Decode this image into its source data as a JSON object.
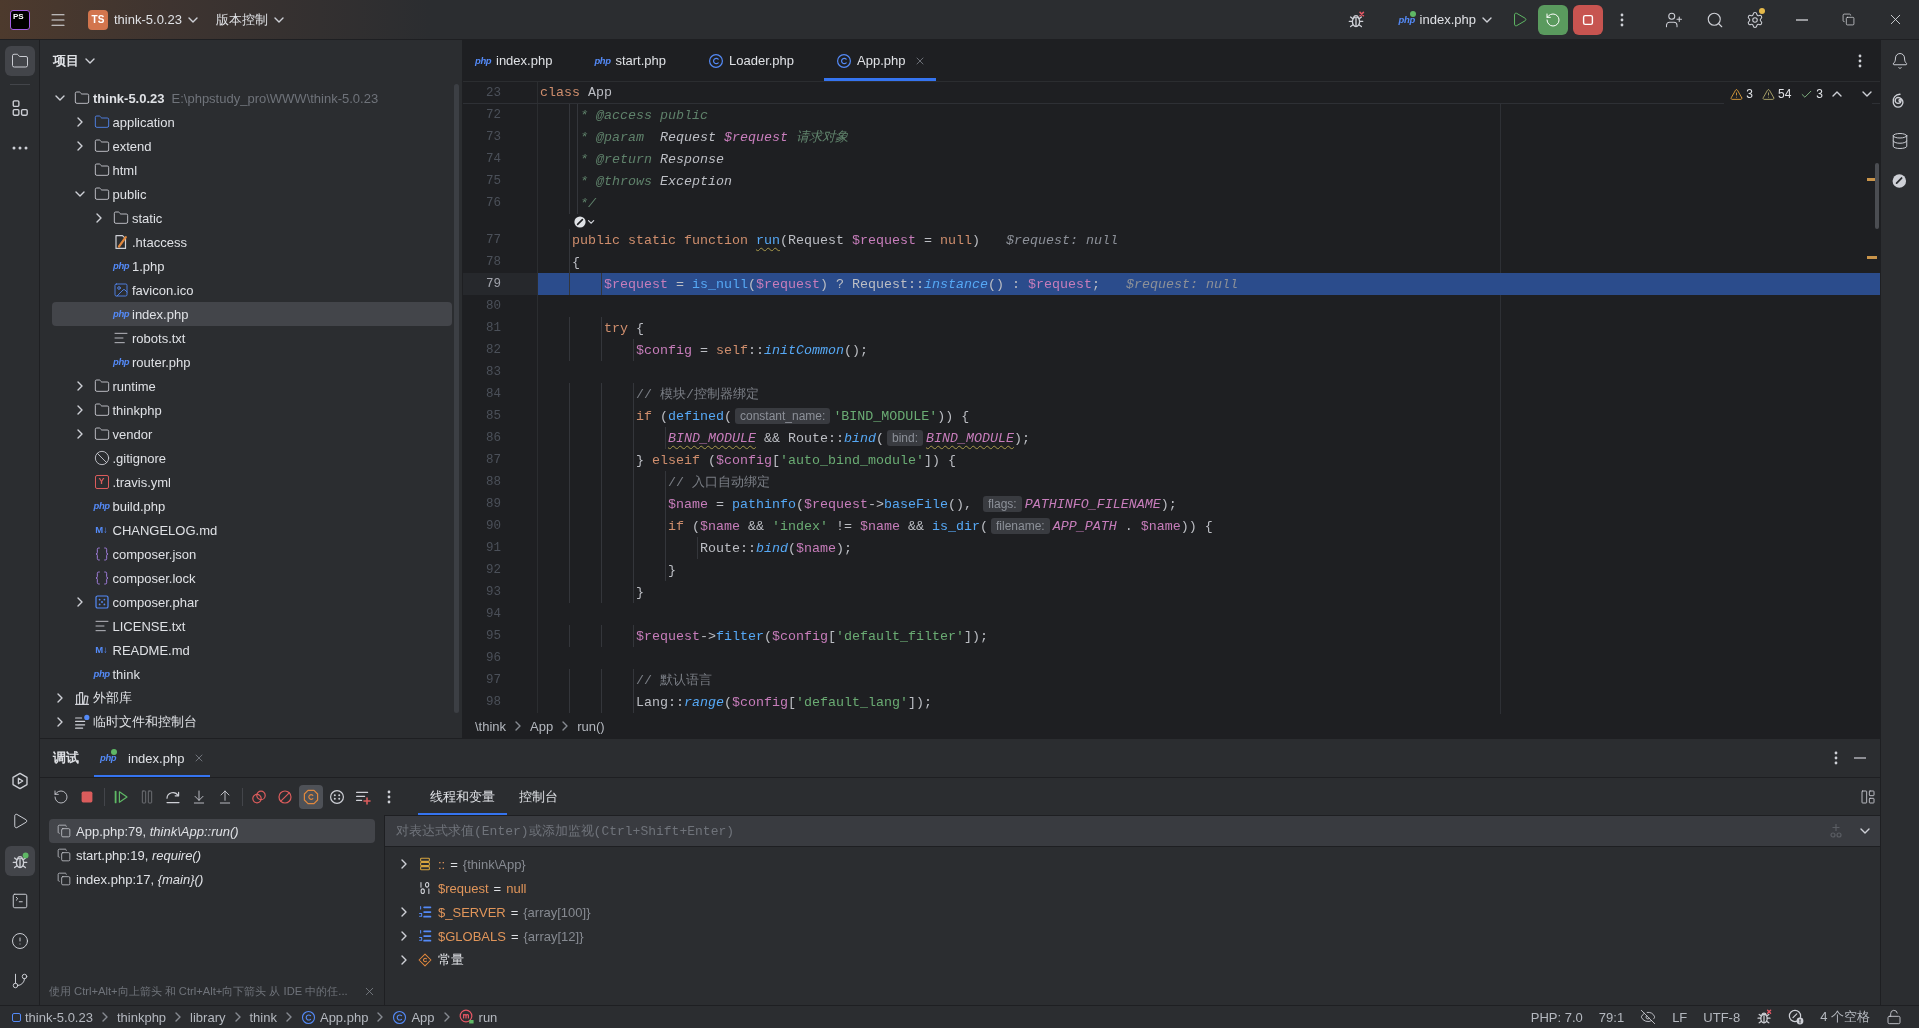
{
  "title_bar": {
    "logo": "PS",
    "project_badge": "TS",
    "project": "think-5.0.23",
    "vcs": "版本控制",
    "run_config": {
      "icon_text": "php",
      "label": "index.php"
    }
  },
  "left_strip": {
    "top": [
      {
        "kind": "project",
        "selected": true
      },
      {
        "kind": "structure",
        "selected": false
      },
      {
        "kind": "more",
        "selected": false
      }
    ],
    "bottom": [
      {
        "kind": "services",
        "selected": false
      },
      {
        "kind": "run",
        "selected": false
      },
      {
        "kind": "debug",
        "selected": true
      },
      {
        "kind": "terminal",
        "selected": false
      },
      {
        "kind": "problems",
        "selected": false
      },
      {
        "kind": "git",
        "selected": false
      }
    ]
  },
  "right_strip": [
    {
      "kind": "notifications",
      "selected": false
    },
    {
      "kind": "assistant",
      "selected": false
    },
    {
      "kind": "database",
      "selected": false
    },
    {
      "kind": "quality",
      "selected": false
    }
  ],
  "project": {
    "title": "项目",
    "tree": [
      {
        "name": "think-5.0.23",
        "path": "E:\\phpstudy_pro\\WWW\\think-5.0.23",
        "kind": "module",
        "expanded": true,
        "selected": false,
        "children": [
          {
            "name": "application",
            "kind": "source_folder",
            "expanded": false,
            "selected": false
          },
          {
            "name": "extend",
            "kind": "folder",
            "expanded": false,
            "selected": false
          },
          {
            "name": "html",
            "kind": "folder",
            "selected": false
          },
          {
            "name": "public",
            "kind": "folder",
            "expanded": true,
            "selected": false,
            "children": [
              {
                "name": "static",
                "kind": "folder",
                "expanded": false,
                "selected": false
              },
              {
                "name": ".htaccess",
                "kind": "htaccess",
                "selected": false
              },
              {
                "name": "1.php",
                "kind": "php",
                "icon_text": "php",
                "selected": false
              },
              {
                "name": "favicon.ico",
                "kind": "image",
                "selected": false
              },
              {
                "name": "index.php",
                "kind": "php",
                "icon_text": "php",
                "selected": true
              },
              {
                "name": "robots.txt",
                "kind": "text",
                "selected": false
              },
              {
                "name": "router.php",
                "kind": "php",
                "icon_text": "php",
                "selected": false
              }
            ]
          },
          {
            "name": "runtime",
            "kind": "folder",
            "expanded": false,
            "selected": false
          },
          {
            "name": "thinkphp",
            "kind": "folder",
            "expanded": false,
            "selected": false
          },
          {
            "name": "vendor",
            "kind": "folder",
            "expanded": false,
            "selected": false
          },
          {
            "name": ".gitignore",
            "kind": "ignore",
            "selected": false
          },
          {
            "name": ".travis.yml",
            "kind": "yaml",
            "icon_text": "Y",
            "selected": false
          },
          {
            "name": "build.php",
            "kind": "php",
            "icon_text": "php",
            "selected": false
          },
          {
            "name": "CHANGELOG.md",
            "kind": "markdown",
            "icon_text": "M↓",
            "selected": false
          },
          {
            "name": "composer.json",
            "kind": "json",
            "selected": false
          },
          {
            "name": "composer.lock",
            "kind": "json",
            "selected": false
          },
          {
            "name": "composer.phar",
            "kind": "archive",
            "expanded": false,
            "selected": false
          },
          {
            "name": "LICENSE.txt",
            "kind": "text",
            "selected": false
          },
          {
            "name": "README.md",
            "kind": "markdown",
            "icon_text": "M↓",
            "selected": false
          },
          {
            "name": "think",
            "kind": "php",
            "icon_text": "php",
            "selected": false
          }
        ]
      },
      {
        "name": "外部库",
        "kind": "library",
        "expanded": false,
        "selected": false
      },
      {
        "name": "临时文件和控制台",
        "kind": "scratches",
        "expanded": false,
        "selected": false
      }
    ]
  },
  "editor": {
    "tabs": [
      {
        "label": "index.php",
        "kind": "php",
        "icon_text": "php",
        "selected": false
      },
      {
        "label": "start.php",
        "kind": "php",
        "icon_text": "php",
        "selected": false
      },
      {
        "label": "Loader.php",
        "kind": "class",
        "selected": false
      },
      {
        "label": "App.php",
        "kind": "class",
        "selected": true
      }
    ],
    "inspections": {
      "warnings": "3",
      "weak_warnings": "54",
      "passed": "3"
    },
    "sticky": {
      "number": "23",
      "tokens": [
        {
          "kind": "kw",
          "text": "class"
        },
        {
          "kind": "text",
          "text": " App"
        }
      ]
    },
    "lines": [
      {
        "kind": "code",
        "number": "72",
        "current": false,
        "tokens": [
          {
            "kind": "doc",
            "text": "     * @access public"
          }
        ]
      },
      {
        "kind": "code",
        "number": "73",
        "current": false,
        "tokens": [
          {
            "kind": "doc",
            "text": "     * @param  "
          },
          {
            "kind": "doc_type",
            "text": "Request "
          },
          {
            "kind": "doc_var",
            "text": "$request"
          },
          {
            "kind": "doc",
            "text": " 请求对象"
          }
        ]
      },
      {
        "kind": "code",
        "number": "74",
        "current": false,
        "tokens": [
          {
            "kind": "doc",
            "text": "     * @return "
          },
          {
            "kind": "doc_type",
            "text": "Response"
          }
        ]
      },
      {
        "kind": "code",
        "number": "75",
        "current": false,
        "tokens": [
          {
            "kind": "doc",
            "text": "     * @throws "
          },
          {
            "kind": "doc_type",
            "text": "Exception"
          }
        ]
      },
      {
        "kind": "code",
        "number": "76",
        "current": false,
        "tokens": [
          {
            "kind": "doc",
            "text": "     */"
          }
        ]
      },
      {
        "kind": "lens"
      },
      {
        "kind": "code",
        "number": "77",
        "current": false,
        "tokens": [
          {
            "kind": "kw",
            "text": "    public static function "
          },
          {
            "kind": "warn_fn",
            "text": "run"
          },
          {
            "kind": "text",
            "text": "(Request "
          },
          {
            "kind": "var",
            "text": "$request"
          },
          {
            "kind": "text",
            "text": " = "
          },
          {
            "kind": "kw",
            "text": "null"
          },
          {
            "kind": "text",
            "text": ")"
          },
          {
            "kind": "debug_value",
            "text": "$request: null"
          }
        ]
      },
      {
        "kind": "code",
        "number": "78",
        "current": false,
        "tokens": [
          {
            "kind": "text",
            "text": "    {"
          }
        ]
      },
      {
        "kind": "code",
        "number": "79",
        "current": true,
        "tokens": [
          {
            "kind": "var",
            "text": "        $request"
          },
          {
            "kind": "text",
            "text": " = "
          },
          {
            "kind": "fn",
            "text": "is_null"
          },
          {
            "kind": "text",
            "text": "("
          },
          {
            "kind": "var",
            "text": "$request"
          },
          {
            "kind": "text",
            "text": ") ? Request::"
          },
          {
            "kind": "static_call",
            "text": "instance"
          },
          {
            "kind": "text",
            "text": "() : "
          },
          {
            "kind": "var",
            "text": "$request"
          },
          {
            "kind": "text",
            "text": ";"
          },
          {
            "kind": "debug_value",
            "text": "$request: null"
          }
        ]
      },
      {
        "kind": "code",
        "number": "80",
        "current": false
      },
      {
        "kind": "code",
        "number": "81",
        "current": false,
        "tokens": [
          {
            "kind": "kw",
            "text": "        try"
          },
          {
            "kind": "text",
            "text": " {"
          }
        ]
      },
      {
        "kind": "code",
        "number": "82",
        "current": false,
        "tokens": [
          {
            "kind": "var",
            "text": "            $config"
          },
          {
            "kind": "text",
            "text": " = "
          },
          {
            "kind": "kw",
            "text": "self"
          },
          {
            "kind": "text",
            "text": "::"
          },
          {
            "kind": "static_call",
            "text": "initCommon"
          },
          {
            "kind": "text",
            "text": "();"
          }
        ]
      },
      {
        "kind": "code",
        "number": "83",
        "current": false
      },
      {
        "kind": "code",
        "number": "84",
        "current": false,
        "tokens": [
          {
            "kind": "comment",
            "text": "            // 模块/控制器绑定"
          }
        ]
      },
      {
        "kind": "code",
        "number": "85",
        "current": false,
        "tokens": [
          {
            "kind": "kw",
            "text": "            if"
          },
          {
            "kind": "text",
            "text": " ("
          },
          {
            "kind": "fn",
            "text": "defined"
          },
          {
            "kind": "text",
            "text": "("
          },
          {
            "kind": "param_hint",
            "text": "constant_name:"
          },
          {
            "kind": "str",
            "text": "'BIND_MODULE'"
          },
          {
            "kind": "text",
            "text": ")) {"
          }
        ]
      },
      {
        "kind": "code",
        "number": "86",
        "current": false,
        "tokens": [
          {
            "kind": "warn_const",
            "text": "                BIND_MODULE"
          },
          {
            "kind": "text",
            "text": " && Route::"
          },
          {
            "kind": "static_call",
            "text": "bind"
          },
          {
            "kind": "text",
            "text": "("
          },
          {
            "kind": "param_hint",
            "text": "bind:"
          },
          {
            "kind": "warn_const",
            "text": "BIND_MODULE"
          },
          {
            "kind": "text",
            "text": ");"
          }
        ]
      },
      {
        "kind": "code",
        "number": "87",
        "current": false,
        "tokens": [
          {
            "kind": "text",
            "text": "            } "
          },
          {
            "kind": "kw",
            "text": "elseif"
          },
          {
            "kind": "text",
            "text": " ("
          },
          {
            "kind": "var",
            "text": "$config"
          },
          {
            "kind": "text",
            "text": "["
          },
          {
            "kind": "str",
            "text": "'auto_bind_module'"
          },
          {
            "kind": "text",
            "text": "]) {"
          }
        ]
      },
      {
        "kind": "code",
        "number": "88",
        "current": false,
        "tokens": [
          {
            "kind": "comment",
            "text": "                // 入口自动绑定"
          }
        ]
      },
      {
        "kind": "code",
        "number": "89",
        "current": false,
        "tokens": [
          {
            "kind": "var",
            "text": "                $name"
          },
          {
            "kind": "text",
            "text": " = "
          },
          {
            "kind": "fn",
            "text": "pathinfo"
          },
          {
            "kind": "text",
            "text": "("
          },
          {
            "kind": "var",
            "text": "$request"
          },
          {
            "kind": "text",
            "text": "->"
          },
          {
            "kind": "fn",
            "text": "baseFile"
          },
          {
            "kind": "text",
            "text": "(), "
          },
          {
            "kind": "param_hint",
            "text": "flags:"
          },
          {
            "kind": "const",
            "text": "PATHINFO_FILENAME"
          },
          {
            "kind": "text",
            "text": ");"
          }
        ]
      },
      {
        "kind": "code",
        "number": "90",
        "current": false,
        "tokens": [
          {
            "kind": "kw",
            "text": "                if"
          },
          {
            "kind": "text",
            "text": " ("
          },
          {
            "kind": "var",
            "text": "$name"
          },
          {
            "kind": "text",
            "text": " && "
          },
          {
            "kind": "str",
            "text": "'index'"
          },
          {
            "kind": "text",
            "text": " != "
          },
          {
            "kind": "var",
            "text": "$name"
          },
          {
            "kind": "text",
            "text": " && "
          },
          {
            "kind": "fn",
            "text": "is_dir"
          },
          {
            "kind": "text",
            "text": "("
          },
          {
            "kind": "param_hint",
            "text": "filename:"
          },
          {
            "kind": "const",
            "text": "APP_PATH"
          },
          {
            "kind": "text",
            "text": " . "
          },
          {
            "kind": "var",
            "text": "$name"
          },
          {
            "kind": "text",
            "text": ")) {"
          }
        ]
      },
      {
        "kind": "code",
        "number": "91",
        "current": false,
        "tokens": [
          {
            "kind": "text",
            "text": "                    Route::"
          },
          {
            "kind": "static_call",
            "text": "bind"
          },
          {
            "kind": "text",
            "text": "("
          },
          {
            "kind": "var",
            "text": "$name"
          },
          {
            "kind": "text",
            "text": ");"
          }
        ]
      },
      {
        "kind": "code",
        "number": "92",
        "current": false,
        "tokens": [
          {
            "kind": "text",
            "text": "                }"
          }
        ]
      },
      {
        "kind": "code",
        "number": "93",
        "current": false,
        "tokens": [
          {
            "kind": "text",
            "text": "            }"
          }
        ]
      },
      {
        "kind": "code",
        "number": "94",
        "current": false
      },
      {
        "kind": "code",
        "number": "95",
        "current": false,
        "tokens": [
          {
            "kind": "var",
            "text": "            $request"
          },
          {
            "kind": "text",
            "text": "->"
          },
          {
            "kind": "fn",
            "text": "filter"
          },
          {
            "kind": "text",
            "text": "("
          },
          {
            "kind": "var",
            "text": "$config"
          },
          {
            "kind": "text",
            "text": "["
          },
          {
            "kind": "str",
            "text": "'default_filter'"
          },
          {
            "kind": "text",
            "text": "]);"
          }
        ]
      },
      {
        "kind": "code",
        "number": "96",
        "current": false
      },
      {
        "kind": "code",
        "number": "97",
        "current": false,
        "tokens": [
          {
            "kind": "comment",
            "text": "            // 默认语言"
          }
        ]
      },
      {
        "kind": "code",
        "number": "98",
        "current": false,
        "tokens": [
          {
            "kind": "text",
            "text": "            Lang::"
          },
          {
            "kind": "static_call",
            "text": "range"
          },
          {
            "kind": "text",
            "text": "("
          },
          {
            "kind": "var",
            "text": "$config"
          },
          {
            "kind": "text",
            "text": "["
          },
          {
            "kind": "str",
            "text": "'default_lang'"
          },
          {
            "kind": "text",
            "text": "]);"
          }
        ]
      }
    ],
    "breadcrumb": [
      "\\think",
      "App",
      "run()"
    ]
  },
  "debug": {
    "title": "调试",
    "sessions": [
      {
        "label": "index.php",
        "icon_text": "php",
        "selected": true
      }
    ],
    "toolbar": [
      {
        "kind": "rerun",
        "disabled": false,
        "on": false
      },
      {
        "kind": "stop",
        "disabled": false,
        "on": false
      },
      {
        "kind": "separator"
      },
      {
        "kind": "resume",
        "disabled": false,
        "on": false
      },
      {
        "kind": "pause",
        "disabled": true,
        "on": false
      },
      {
        "kind": "step_over",
        "disabled": false,
        "on": false
      },
      {
        "kind": "step_into",
        "disabled": false,
        "on": false
      },
      {
        "kind": "step_out",
        "disabled": false,
        "on": false
      },
      {
        "kind": "separator"
      },
      {
        "kind": "breakpoints",
        "disabled": false,
        "on": false
      },
      {
        "kind": "mute",
        "disabled": false,
        "on": false
      },
      {
        "kind": "octagon",
        "disabled": false,
        "on": true
      },
      {
        "kind": "dots",
        "disabled": false,
        "on": false
      },
      {
        "kind": "list_add",
        "disabled": false,
        "on": false
      },
      {
        "kind": "more",
        "disabled": false,
        "on": false
      }
    ],
    "tabs": [
      {
        "label": "线程和变量",
        "selected": true
      },
      {
        "label": "控制台",
        "selected": false
      }
    ],
    "frames": [
      {
        "location": "App.php:79,",
        "method": "think\\App::run()",
        "selected": true
      },
      {
        "location": "start.php:19,",
        "method": "require()",
        "selected": false
      },
      {
        "location": "index.php:17,",
        "method": "{main}()",
        "selected": false
      }
    ],
    "hint": "使用 Ctrl+Alt+向上箭头 和 Ctrl+Alt+向下箭头 从 IDE 中的任...",
    "evaluate": {
      "placeholder": "对表达式求值(Enter)或添加监视(Ctrl+Shift+Enter)"
    },
    "variables": [
      {
        "kind": "object",
        "name": "::",
        "operator": "=",
        "value": "{think\\App}",
        "expanded": false
      },
      {
        "kind": "scalar",
        "name": "$request",
        "operator": "=",
        "value": "null"
      },
      {
        "kind": "array",
        "name": "$_SERVER",
        "operator": "=",
        "value": "{array[100]}",
        "expanded": false
      },
      {
        "kind": "array",
        "name": "$GLOBALS",
        "operator": "=",
        "value": "{array[12]}",
        "expanded": false
      },
      {
        "kind": "constants",
        "name": "常量",
        "expanded": false
      }
    ]
  },
  "status_bar": {
    "path": [
      {
        "kind": "module",
        "label": "think-5.0.23"
      },
      {
        "kind": "folder",
        "label": "thinkphp"
      },
      {
        "kind": "folder",
        "label": "library"
      },
      {
        "kind": "folder",
        "label": "think"
      },
      {
        "kind": "class",
        "label": "App.php"
      },
      {
        "kind": "class",
        "label": "App"
      },
      {
        "kind": "method",
        "label": "run"
      }
    ],
    "items": [
      {
        "kind": "text",
        "label": "PHP: 7.0"
      },
      {
        "kind": "text",
        "label": "79:1"
      },
      {
        "kind": "hidden"
      },
      {
        "kind": "text",
        "label": "LF"
      },
      {
        "kind": "text",
        "label": "UTF-8"
      },
      {
        "kind": "debugger"
      },
      {
        "kind": "quality"
      },
      {
        "kind": "text",
        "label": "4 个空格"
      },
      {
        "kind": "lock"
      }
    ]
  }
}
